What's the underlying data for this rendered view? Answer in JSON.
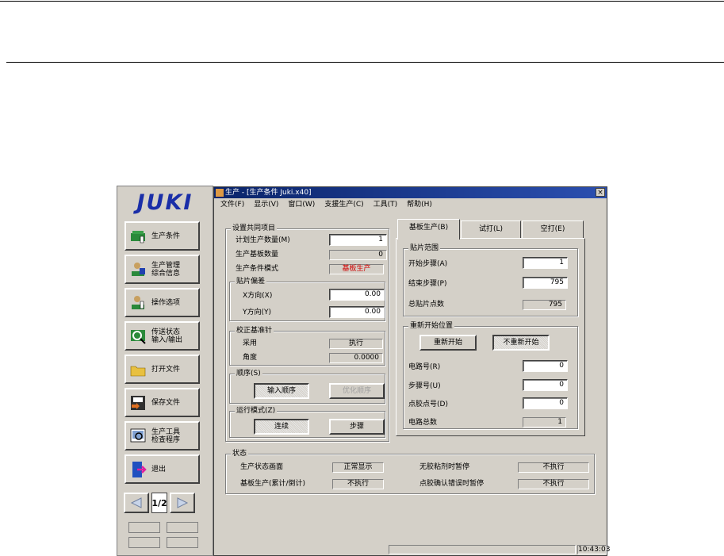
{
  "side": {
    "logo": "JUKI",
    "buttons": [
      {
        "label": "生产条件",
        "icon": "production-conditions-icon"
      },
      {
        "label": "生产管理\n综合信息",
        "icon": "production-management-icon"
      },
      {
        "label": "操作选项",
        "icon": "operation-options-icon"
      },
      {
        "label": "传送状态\n输入/输出",
        "icon": "transfer-status-icon"
      },
      {
        "label": "打开文件",
        "icon": "open-folder-icon"
      },
      {
        "label": "保存文件",
        "icon": "save-file-icon"
      },
      {
        "label": "生产工具\n检查程序",
        "icon": "tool-check-icon"
      },
      {
        "label": "退出",
        "icon": "exit-door-icon"
      }
    ],
    "page_indicator": "1/2"
  },
  "window": {
    "title": "生产 - [生产条件 Juki.x40]",
    "close": "×",
    "menu": [
      "文件(F)",
      "显示(V)",
      "窗口(W)",
      "支援生产(C)",
      "工具(T)",
      "帮助(H)"
    ]
  },
  "common": {
    "title": "设置共同项目",
    "planned_qty_label": "计划生产数量(M)",
    "planned_qty_value": "1",
    "boards_label": "生产基板数量",
    "boards_value": "0",
    "mode_label": "生产条件模式",
    "mode_value": "基板生产",
    "offset": {
      "title": "贴片偏差",
      "x_label": "X方向(X)",
      "x_value": "0.00",
      "y_label": "Y方向(Y)",
      "y_value": "0.00"
    },
    "fiducial": {
      "title": "校正基准针",
      "use_label": "采用",
      "use_value": "执行",
      "angle_label": "角度",
      "angle_value": "0.0000"
    },
    "order": {
      "title": "顺序(S)",
      "input_btn": "输入顺序",
      "optimize_btn": "优化顺序"
    },
    "run_mode": {
      "title": "运行模式(Z)",
      "continuous_btn": "连续",
      "step_btn": "步骤"
    }
  },
  "tabs": [
    "基板生产(B)",
    "试打(L)",
    "空打(E)"
  ],
  "placement_range": {
    "title": "贴片范围",
    "start_label": "开始步骤(A)",
    "start_value": "1",
    "end_label": "结束步骤(P)",
    "end_value": "795",
    "total_label": "总贴片点数",
    "total_value": "795"
  },
  "restart": {
    "title": "重新开始位置",
    "restart_btn": "重新开始",
    "no_restart_btn": "不重新开始",
    "circuit_label": "电路号(R)",
    "circuit_value": "0",
    "step_label": "步骤号(U)",
    "step_value": "0",
    "dispense_label": "点胶点号(D)",
    "dispense_value": "0",
    "circuit_total_label": "电路总数",
    "circuit_total_value": "1"
  },
  "status": {
    "title": "状态",
    "screen_label": "生产状态画面",
    "screen_value": "正常显示",
    "count_label": "基板生产(累计/倒计)",
    "count_value": "不执行",
    "noglue_label": "无胶粘剂时暂停",
    "noglue_value": "不执行",
    "glue_err_label": "点胶确认错误时暂停",
    "glue_err_value": "不执行"
  },
  "statusbar": {
    "time": "10:43:03"
  },
  "colors": {
    "accent_red": "#d00000",
    "title_blue": "#0a246a",
    "logo_blue": "#1a2ea8"
  }
}
